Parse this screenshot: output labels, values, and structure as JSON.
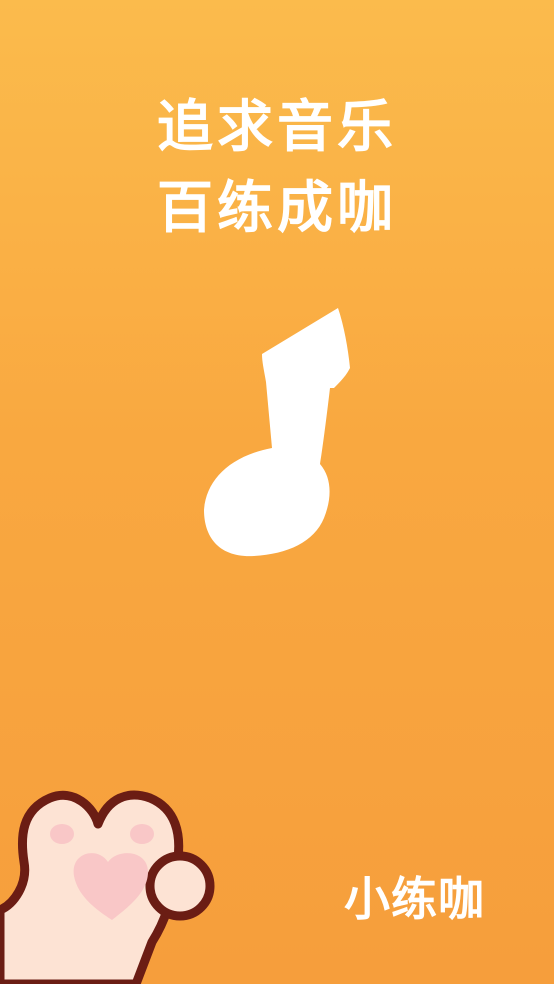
{
  "splash": {
    "slogan_line1": "追求音乐",
    "slogan_line2": "百练成咖",
    "center_icon": "music-note-icon",
    "mascot_icon": "paw-icon",
    "brand_name": "小练咖"
  },
  "colors": {
    "background_top": "#fbbb4c",
    "background_bottom": "#f69e3c",
    "text": "#ffffff",
    "paw_outline": "#6b1d14",
    "paw_fill": "#fde3d4",
    "paw_pad": "#f9c7c7"
  }
}
